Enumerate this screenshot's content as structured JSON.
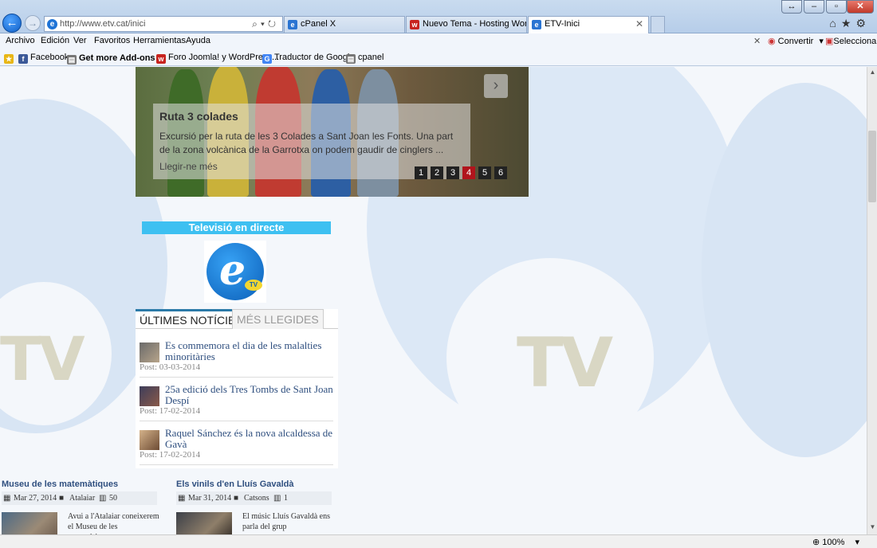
{
  "browser": {
    "address_url": "http://www.etv.cat/inici",
    "tabs": [
      {
        "label": "cPanel X",
        "icon": "cpanel-tab-icon"
      },
      {
        "label": "Nuevo Tema - Hosting WordP...",
        "icon": "webempresa-tab-icon"
      },
      {
        "label": "ETV-Inici",
        "icon": "ie-tab-icon",
        "active": true
      }
    ],
    "menu": [
      "Archivo",
      "Edición",
      "Ver",
      "Favoritos",
      "Herramientas",
      "Ayuda"
    ],
    "menu_right": {
      "convert": "Convertir",
      "select": "Seleccionar"
    },
    "favorites": [
      "Facebook",
      "Get more Add-ons",
      "Foro Joomla! y WordPress...",
      "Traductor de Google",
      "cpanel"
    ],
    "zoom": "100%"
  },
  "slider": {
    "title": "Ruta 3 colades",
    "text": "Excursió per la ruta de les 3 Colades a Sant Joan les Fonts. Una part de la zona volcànica de la Garrotxa on podem gaudir de cinglers ...",
    "more": "Llegir-ne més",
    "pages": [
      "1",
      "2",
      "3",
      "4",
      "5",
      "6"
    ],
    "active_page": 4
  },
  "tv": {
    "header": "Televisió en directe",
    "logo_badge": "TV"
  },
  "background": {
    "watermark": "TV"
  },
  "news": {
    "tabs": [
      "ÚLTIMES NOTÍCIES",
      "MÉS LLEGIDES"
    ],
    "items": [
      {
        "title": "Es commemora el dia de les malalties minoritàries",
        "date": "Post: 03-03-2014"
      },
      {
        "title": "25a edició dels Tres Tombs de Sant Joan Despí",
        "date": "Post: 17-02-2014"
      },
      {
        "title": "Raquel Sánchez és la nova alcaldessa de Gavà",
        "date": "Post: 17-02-2014"
      }
    ]
  },
  "posts": [
    {
      "title": "Museu de les matemàtiques",
      "date": "Mar 27, 2014",
      "category": "Atalaiar",
      "views": "50",
      "excerpt": "Avui a l'Atalaiar coneixerem el Museu de les matemàtiques..."
    },
    {
      "title": "Els vinils d'en Lluís Gavaldà",
      "date": "Mar 31, 2014",
      "category": "Catsons",
      "views": "1",
      "excerpt": "El músic Lluís Gavaldà ens parla del grup"
    }
  ]
}
